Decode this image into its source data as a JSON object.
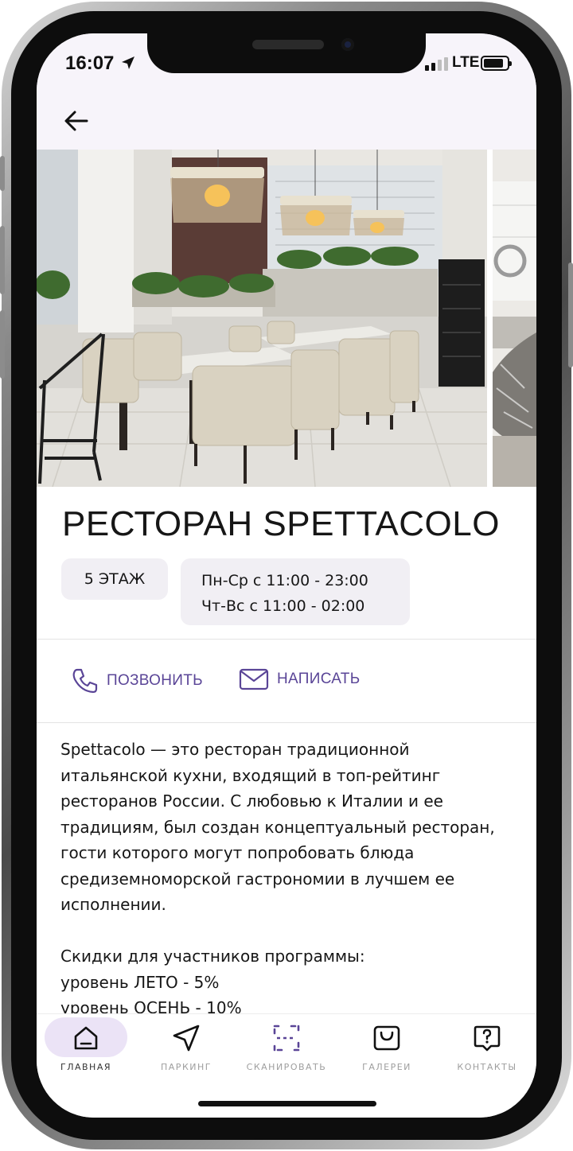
{
  "status_bar": {
    "time": "16:07",
    "network": "LTE",
    "icons": [
      "location-arrow-icon",
      "signal-icon",
      "battery-icon"
    ]
  },
  "header": {
    "back_icon": "arrow-left-icon"
  },
  "venue": {
    "title": "РЕСТОРАН SPETTACOLO",
    "floor": "5 ЭТАЖ",
    "hours": [
      "Пн-Ср с 11:00 - 23:00",
      "Чт-Вс с 11:00 - 02:00"
    ]
  },
  "actions": {
    "call": {
      "label": "ПОЗВОНИТЬ",
      "icon": "phone-icon"
    },
    "write": {
      "label": "НАПИСАТЬ",
      "icon": "mail-icon"
    }
  },
  "description": {
    "lines": [
      "Spettacolo — это ресторан традиционной",
      "итальянской кухни, входящий в топ-рейтинг",
      "ресторанов России. С любовью к Италии и ее",
      "традициям, был создан концептуальный ресторан,",
      "гости которого могут попробовать блюда",
      "средиземноморской гастрономии в лучшем ее",
      "исполнении."
    ],
    "discount_lines": [
      "Скидки для участников программы:",
      "уровень ЛЕТО - 5%",
      "уровень ОСЕНЬ - 10%"
    ]
  },
  "nav": [
    {
      "label": "ГЛАВНАЯ",
      "icon": "home-icon",
      "active": true
    },
    {
      "label": "ПАРКИНГ",
      "icon": "navigation-arrow-icon",
      "active": false
    },
    {
      "label": "СКАНИРОВАТЬ",
      "icon": "scan-icon",
      "active": false
    },
    {
      "label": "ГАЛЕРЕИ",
      "icon": "shopping-bag-icon",
      "active": false
    },
    {
      "label": "КОНТАКТЫ",
      "icon": "help-chat-icon",
      "active": false
    }
  ],
  "colors": {
    "accent": "#5a4597",
    "chip_bg": "#f1eff4",
    "nav_pill": "#ebe3f6",
    "header_bg": "#f7f4fa"
  }
}
